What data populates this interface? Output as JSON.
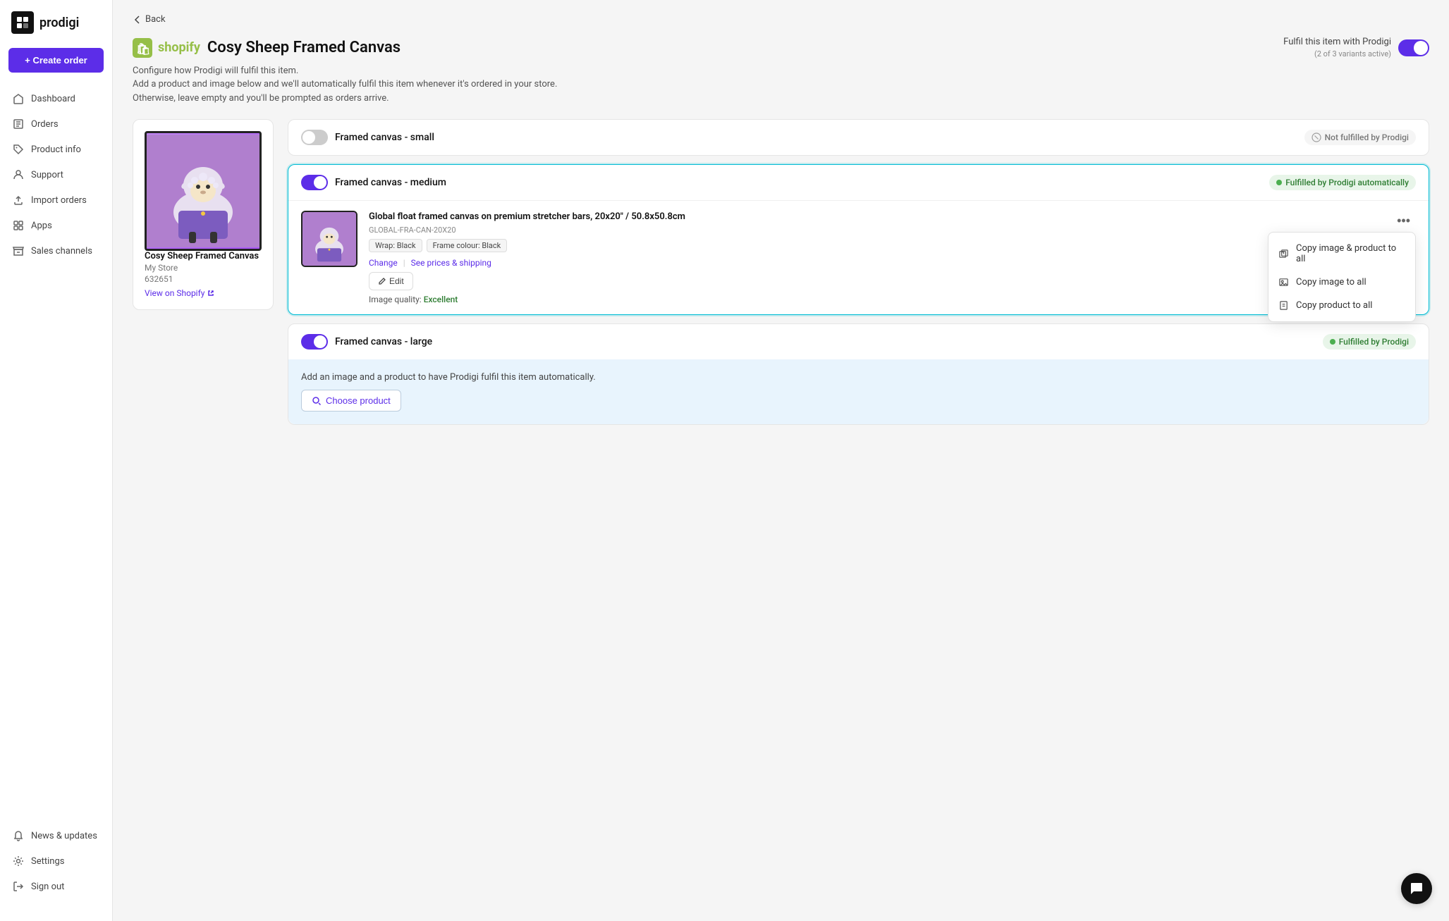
{
  "sidebar": {
    "logo_text": "prodigi",
    "create_order_label": "+ Create order",
    "nav_items": [
      {
        "id": "dashboard",
        "label": "Dashboard",
        "icon": "home"
      },
      {
        "id": "orders",
        "label": "Orders",
        "icon": "list"
      },
      {
        "id": "product-info",
        "label": "Product info",
        "icon": "tag"
      },
      {
        "id": "support",
        "label": "Support",
        "icon": "person"
      },
      {
        "id": "import-orders",
        "label": "Import orders",
        "icon": "upload"
      },
      {
        "id": "apps",
        "label": "Apps",
        "icon": "grid"
      },
      {
        "id": "sales-channels",
        "label": "Sales channels",
        "icon": "store"
      }
    ],
    "bottom_items": [
      {
        "id": "news-updates",
        "label": "News & updates",
        "icon": "bell"
      },
      {
        "id": "settings",
        "label": "Settings",
        "icon": "gear"
      },
      {
        "id": "sign-out",
        "label": "Sign out",
        "icon": "signout"
      }
    ]
  },
  "back_link": "Back",
  "page": {
    "shopify_icon": "🛒",
    "title": "Cosy Sheep Framed Canvas",
    "subtitle_configure": "Configure how Prodigi will fulfil this item.",
    "subtitle_add": "Add a product and image below and we'll automatically fulfil this item whenever it's ordered in your store.",
    "subtitle_otherwise": "Otherwise, leave empty and you'll be prompted as orders arrive.",
    "fulfil_label": "Fulfil this item with Prodigi",
    "fulfil_sub": "(2 of 3 variants active)"
  },
  "product_card": {
    "name": "Cosy Sheep Framed Canvas",
    "store": "My Store",
    "id": "632651",
    "view_label": "View on Shopify",
    "emoji": "🐑"
  },
  "variants": [
    {
      "id": "small",
      "name": "Framed canvas - small",
      "enabled": false,
      "status": "Not fulfilled by Prodigi",
      "status_type": "not-fulfilled",
      "has_product": false
    },
    {
      "id": "medium",
      "name": "Framed canvas - medium",
      "enabled": true,
      "status": "Fulfilled by Prodigi automatically",
      "status_type": "fulfilled",
      "has_product": true,
      "product": {
        "name": "Global float framed canvas on premium stretcher bars, 20x20\" / 50.8x50.8cm",
        "sku": "GLOBAL-FRA-CAN-20X20",
        "tags": [
          "Wrap: Black",
          "Frame colour: Black"
        ],
        "change_label": "Change",
        "prices_label": "See prices & shipping",
        "edit_label": "Edit",
        "image_quality_label": "Image quality:",
        "image_quality_value": "Excellent",
        "emoji": "🐑"
      }
    },
    {
      "id": "large",
      "name": "Framed canvas - large",
      "enabled": true,
      "status": "Fulfilled by Prodigi",
      "status_type": "fulfilled",
      "has_product": false,
      "add_product_text": "Add an image and a product to have Prodigi fulfil this item automatically.",
      "choose_product_label": "Choose product"
    }
  ],
  "dropdown_menu": {
    "items": [
      {
        "id": "copy-image-product",
        "label": "Copy image & product to all",
        "icon": "copy-both"
      },
      {
        "id": "copy-image",
        "label": "Copy image to all",
        "icon": "copy-image"
      },
      {
        "id": "copy-product",
        "label": "Copy product to all",
        "icon": "copy-product"
      }
    ]
  },
  "chat_bubble": {
    "icon": "chat"
  }
}
